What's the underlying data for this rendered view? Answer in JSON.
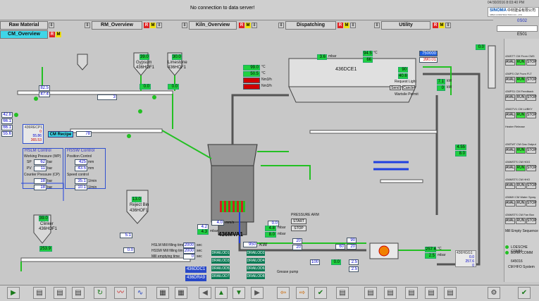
{
  "header": {
    "message": "No connection to data server!",
    "datetime": "04/30/2016 8:03:40 PM",
    "logo_cn": "中材建设有限公司",
    "logo_brand": "SINOMA",
    "logo_sub": "CBMI CONSTRUCTION CO., LTD",
    "area_code": "0S02",
    "status_code": "E501"
  },
  "nav": [
    {
      "label": "Raw Material",
      "active": false
    },
    {
      "label": "RM_Overview",
      "active": false
    },
    {
      "label": "Kiln_Overview",
      "active": false
    },
    {
      "label": "Dispatching",
      "active": false
    },
    {
      "label": "Utility",
      "active": false
    },
    {
      "label": "CM_Overview",
      "active": true
    }
  ],
  "mill": {
    "name": "436MVA1",
    "power": "950",
    "power_unit": "KW",
    "separator_speed": "4.0",
    "separator_unit": "mm/s",
    "motor_label": "436HOF1"
  },
  "top_values": {
    "gypsum_label": "Gypsum",
    "limestone_label": "Limestone",
    "gypsum_hopper": "436HOF1",
    "limestone_hopper": "436HOF1",
    "gypsum_level": "39.0",
    "limestone_level": "30.0",
    "gypsum_flow": "0.0",
    "limestone_flow": "0.0",
    "feed_flow": "82.5",
    "feed_pct": "47.4",
    "belt_flow": "3",
    "left_vals": [
      "42.8",
      "66.1",
      "66.1",
      "55.6"
    ]
  },
  "recipe": {
    "title": "CM Recipe",
    "code": "436RECP1",
    "value": "78",
    "val1": "0",
    "val2": "55.86",
    "val3": "365.53",
    "hslm_title": "HSLM Control",
    "hssw_title": "HSSW Control",
    "working_pressure_label": "Working Pressure (WP)",
    "position_control_label": "Position Control",
    "counter_pressure_label": "Counter Pressure (CP)",
    "speed_control_label": "Speed control",
    "sp1": "62",
    "sp1_unit": "bar",
    "sp2": "11",
    "sp2_unit": "bar",
    "sp3": "18",
    "sp3_unit": "bar",
    "sp4": "18",
    "sp4_unit": "bar",
    "pos1": "425",
    "pos1_unit": "mm",
    "pos2": "43.5",
    "pos2_unit": "mm",
    "spd1": "35.1",
    "spd1_unit": "1/min",
    "spd2": "10.1",
    "spd2_unit": "1/min",
    "sp_label": "SP",
    "pv_label": "PV"
  },
  "reject": {
    "label": "Reject Bin",
    "level": "13.0",
    "hopper": "436HOF1",
    "flow": "5.1"
  },
  "clinker": {
    "label": "Clinker",
    "code": "436HOF1",
    "level": "39.0",
    "flow": "253.9",
    "flow2": "0.0"
  },
  "filter": {
    "name": "436DCE1",
    "pressure": "3.6",
    "pressure_unit": "mbar",
    "request_light": "Request Light",
    "send_label": "Send",
    "cancel_label": "Cancle",
    "permit_label": "Wartsile Permit",
    "temp": "94.5",
    "temp_unit": "°C",
    "diff": "66",
    "flow_unit": "Nm3/h",
    "flow_val": "750000",
    "flow_sp": "390.01",
    "flow_val2": "90",
    "flow_val3": "40.6",
    "temps": [
      "99.0",
      "50.5",
      "",
      ""
    ],
    "temp_units": [
      "°C",
      "°C",
      "Nm3/h",
      "Nm3/h"
    ]
  },
  "circuit": {
    "kw1": "7.1",
    "kw2": "0",
    "kw3": "4.55",
    "kw4": "8.0",
    "kw_unit": "kW",
    "fan_pct": "0.0",
    "val_a": "4.2",
    "val_b": "0.0",
    "mbar_vals": [
      "4.3",
      "4.8",
      "8.0"
    ],
    "mbar_unit": "mbar",
    "grease_label": "Grease pump",
    "pressure_label": "PRESSURE ARM",
    "start_label": "START",
    "stop_label": "STOP",
    "small_vals": [
      "20",
      "60",
      "90",
      "20",
      "20",
      "100",
      "0.0",
      "2.5",
      "2.5"
    ]
  },
  "hslm": {
    "fill_label": "HSLM Mill filling time",
    "full_label": "HSSW Mill filling time",
    "empty_label": "Mill emptying time",
    "fill_val": "2000",
    "full_val": "2000",
    "empty_val": "0",
    "sec_unit": "sec"
  },
  "dgrn": [
    "DRAILOD1",
    "DRAILOD2",
    "DRAILOD3",
    "DRAILOD4",
    "DRAILOD5",
    "DRAILOD6",
    "DRAILOD7",
    "DRAILOD8"
  ],
  "tags": [
    "436DDC1",
    "436DRA9"
  ],
  "hot_gas": {
    "temp": "257.6",
    "temp_unit": "°C",
    "pres": "2.5",
    "pres_unit": "mbar",
    "code": "436HGG1",
    "sub1": "0.0",
    "sub2": "257.6",
    "sub3": "0"
  },
  "sidebar": {
    "title_code": "436DCE1",
    "rows": [
      {
        "code": "436STT CM From CM3",
        "labels": [
          "AVAL",
          "RUN",
          "STOP"
        ],
        "green": 1
      },
      {
        "code": "436PS CM From FLT",
        "labels": [
          "AVAL",
          "RUN",
          "STOP"
        ],
        "green": 1
      },
      {
        "code": "436PS1 CM Feedback",
        "labels": [
          "AVAL",
          "RUN",
          "STOP"
        ],
        "green": 0
      },
      {
        "code": "436GTV1 CM LUBKY",
        "labels": [
          "AVAL",
          "RUN",
          "STOP"
        ],
        "green": 1
      },
      {
        "code": "Heater Release",
        "labels": [],
        "green": 0
      },
      {
        "code": "436TMT CM Gas Output",
        "labels": [
          "AVAL",
          "RUN",
          "STOP"
        ],
        "green": 1
      },
      {
        "code": "436MSTS CM HGG",
        "labels": [
          "AVAL",
          "RUN",
          "STOP"
        ],
        "green": 1
      },
      {
        "code": "436MSTS CM HHO",
        "labels": [
          "AVAL",
          "RUN",
          "STOP"
        ],
        "green": 0
      },
      {
        "code": "436MH CM Water Spray",
        "labels": [
          "AVAL",
          "RUN",
          "STOP"
        ],
        "green": 0
      },
      {
        "code": "436MSTS CM Fan Box",
        "labels": [
          "AVAL",
          "RUN",
          "STOP"
        ],
        "green": 0
      }
    ],
    "seq_label": "Mill Empty Sequence",
    "loesche_comm": "LOESCHE COMM",
    "bdnk_comm": "BDNK COMM",
    "hfo_code": "645016",
    "hfo_label": "CM HFO System"
  },
  "colors": {
    "green": "#23c023",
    "blue_line": "#2040e0",
    "red_alarm": "#e02020",
    "cyan_tab": "#3fd6e8"
  }
}
